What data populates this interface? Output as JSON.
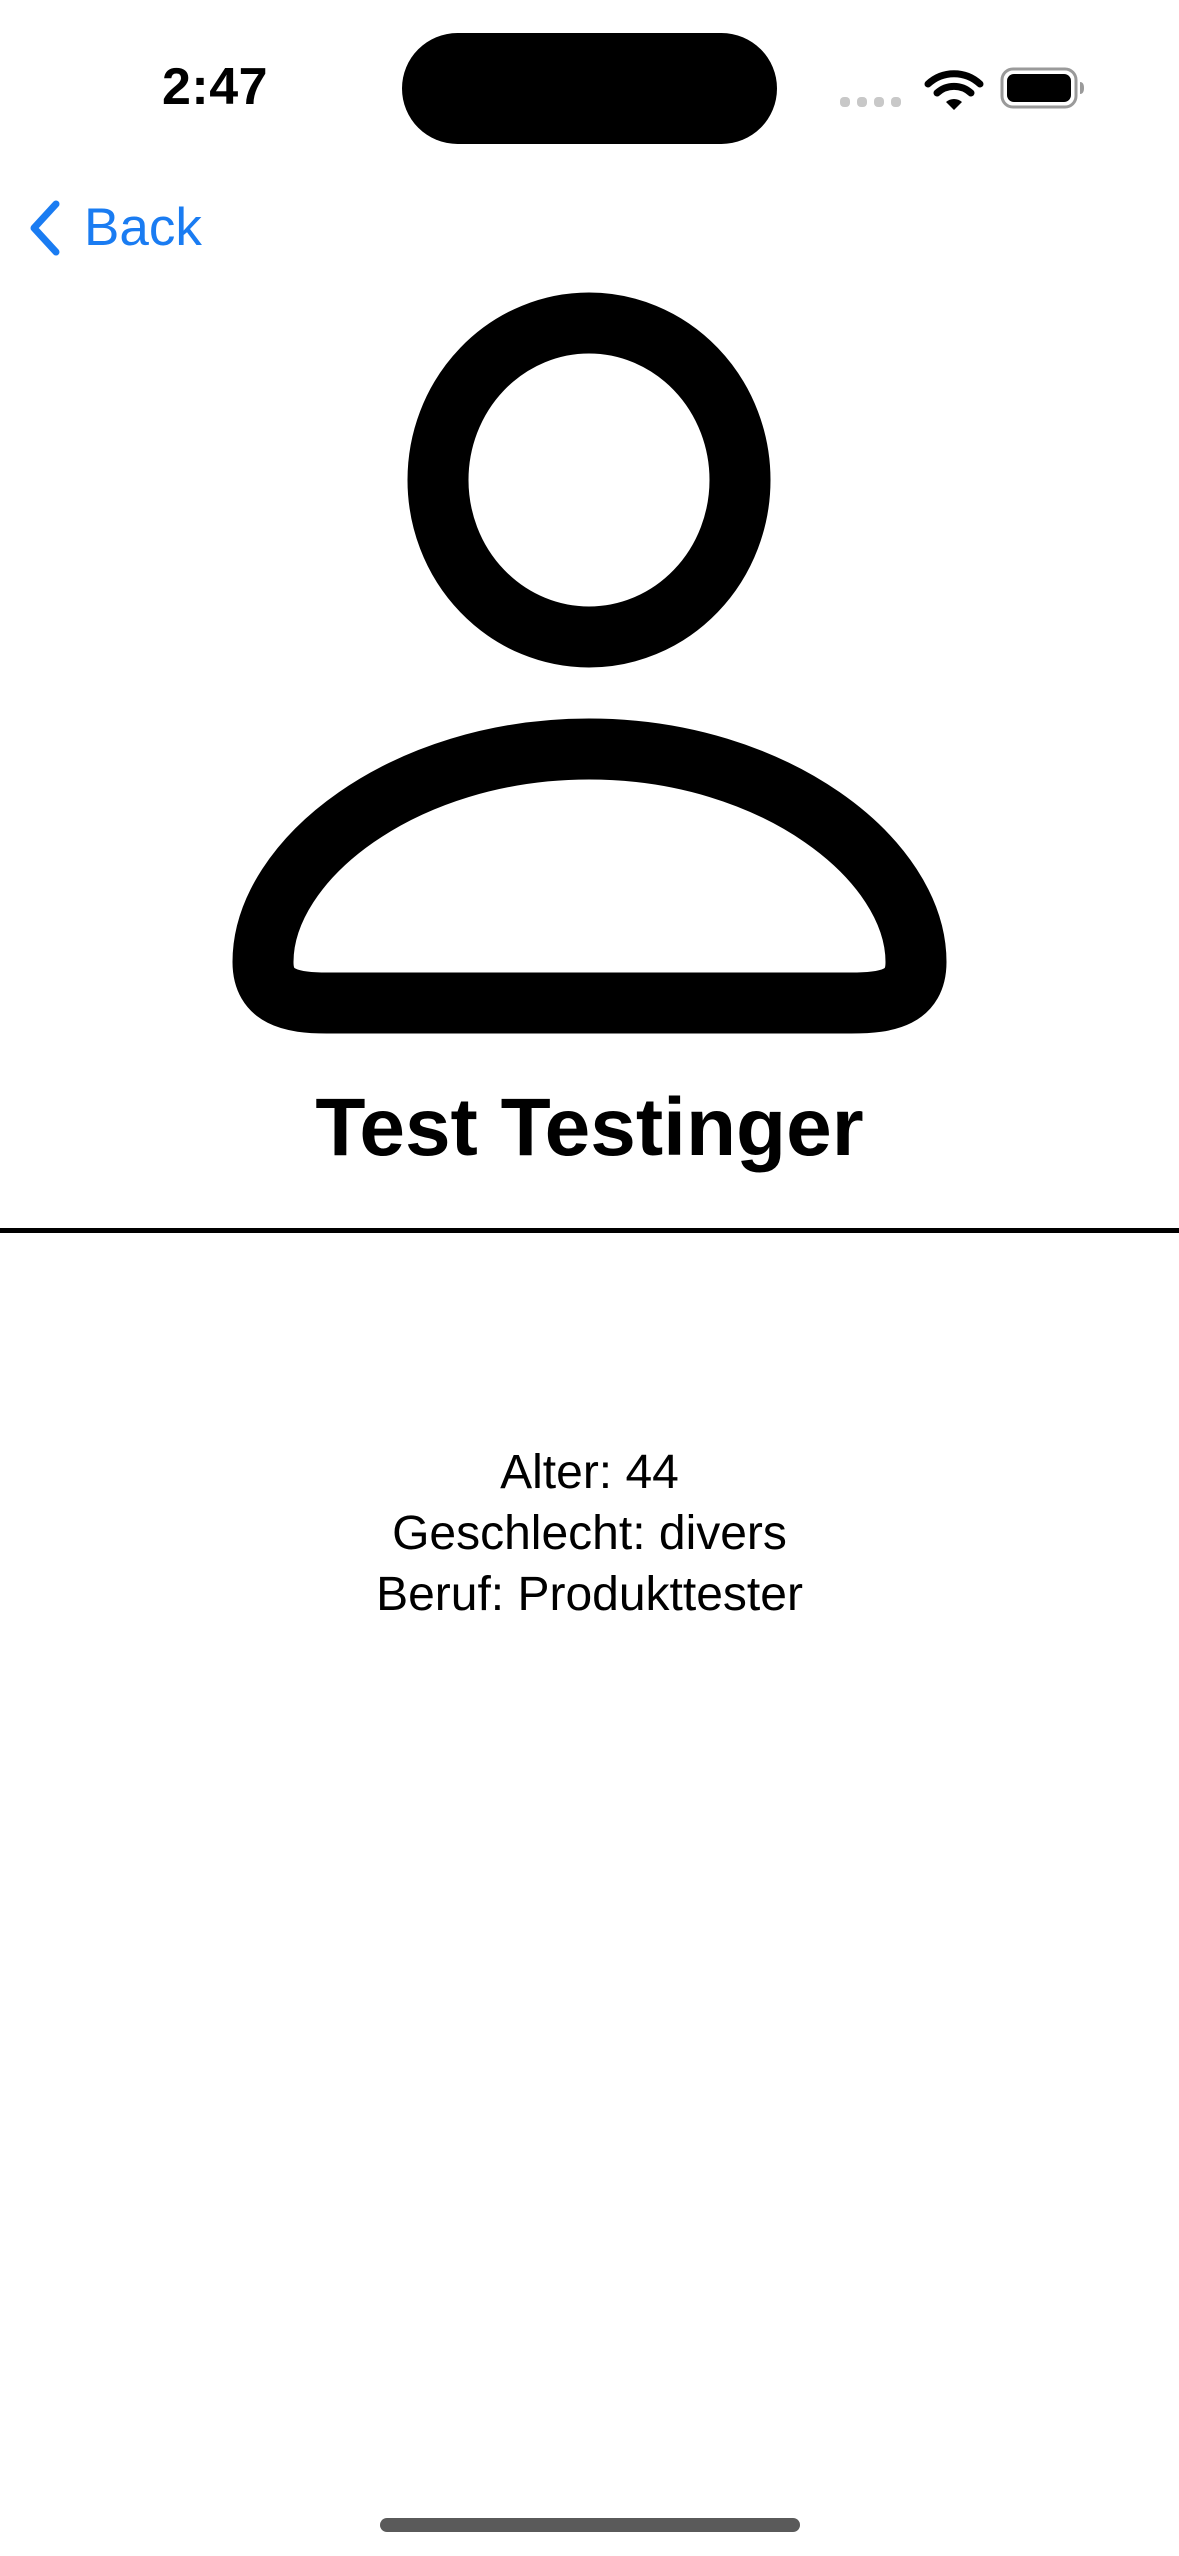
{
  "status_bar": {
    "time": "2:47"
  },
  "nav": {
    "back_label": "Back",
    "accent_color": "#1a7cf2"
  },
  "profile": {
    "avatar_icon": "person-icon",
    "name": "Test Testinger",
    "details": [
      "Alter: 44",
      "Geschlecht: divers",
      "Beruf: Produkttester"
    ]
  }
}
